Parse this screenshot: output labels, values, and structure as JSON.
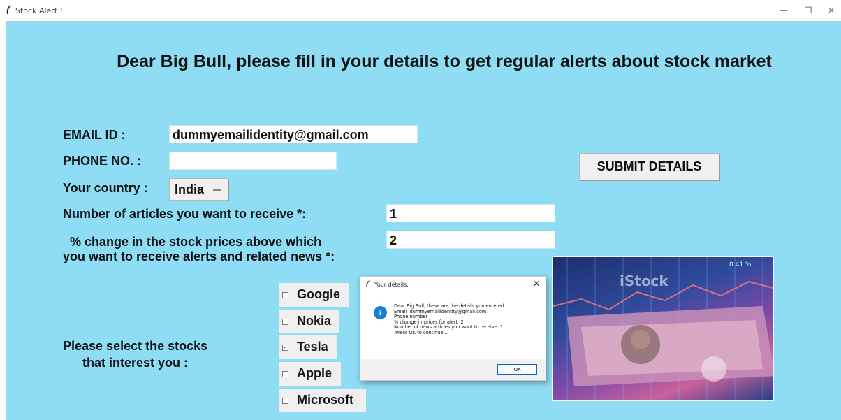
{
  "window": {
    "title": "Stock Alert !",
    "controls": {
      "minimize": "—",
      "restore": "❐",
      "close": "✕"
    }
  },
  "form": {
    "heading": "Dear Big Bull, please fill in your details to get regular alerts about stock market",
    "email_label": "EMAIL ID  :",
    "email_value": "dummyemailidentity@gmail.com",
    "phone_label": "PHONE NO. :",
    "phone_value": "",
    "country_label": "Your country :",
    "country_value": "India",
    "articles_label": "Number of articles you want to receive *:",
    "articles_value": "1",
    "change_label_line1": "% change in the stock prices above which",
    "change_label_line2": "you want to receive alerts and related news *:",
    "change_value": "2",
    "submit_label": "SUBMIT DETAILS",
    "stocks_label_line1": "Please select the stocks",
    "stocks_label_line2": "that interest you :",
    "stocks": [
      {
        "label": "Google",
        "checked": false
      },
      {
        "label": "Nokia",
        "checked": false
      },
      {
        "label": "Tesla",
        "checked": true
      },
      {
        "label": "Apple",
        "checked": false
      },
      {
        "label": "Microsoft",
        "checked": false
      }
    ]
  },
  "image": {
    "watermark": "iStock",
    "ticker": "0.41 %"
  },
  "dialog": {
    "title": "Your details:",
    "close": "✕",
    "icon": "i",
    "message": "Dear Big Bull, these are the details you entered :\nEmail :dummyemailidentity@gmail.com\nPhone number :\n% change in prices for alert :2\nNumber of news articles you want to receive :1\n Press OK to continue...",
    "ok_label": "OK"
  },
  "colors": {
    "background": "#8fdcf5",
    "info_icon": "#1c7dd6",
    "ok_border": "#0a66c8"
  },
  "icons": {
    "app": "feather-icon",
    "dialog_app": "feather-icon",
    "dialog_message": "info-icon"
  }
}
